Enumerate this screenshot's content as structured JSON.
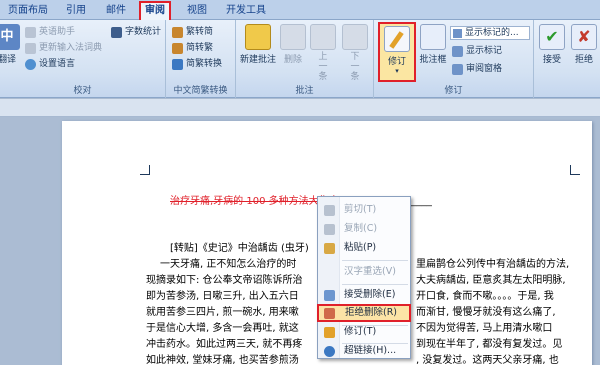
{
  "tabs": [
    "页面布局",
    "引用",
    "邮件",
    "审阅",
    "视图",
    "开发工具"
  ],
  "proofing": {
    "translate": "翻译",
    "english_assistant": "英语助手",
    "update_ime": "更新输入法词典",
    "set_language": "设置语言",
    "word_count": "字数统计",
    "group_label": "校对"
  },
  "chinese_convert": {
    "to_simplified": "繁转简",
    "to_traditional": "简转繁",
    "convert": "简繁转换",
    "group_label": "中文简繁转换"
  },
  "comments": {
    "new": "新建批注",
    "delete": "删除",
    "prev": "上一条",
    "next": "下一条",
    "group_label": "批注"
  },
  "tracking": {
    "track_changes": "修订",
    "balloons": "批注框",
    "display_for_review": "显示标记的...",
    "show_markup": "显示标记",
    "reviewing_pane": "审阅窗格",
    "group_label": "修订"
  },
  "changes": {
    "accept": "接受",
    "reject": "拒绝"
  },
  "document": {
    "deleted_line": "治疗牙痛,牙病的 100 多种方法大集合",
    "underline_tail": "____________",
    "lines": [
      "[转贴]《史记》中治龋齿 (虫牙)",
      "一天牙痛, 正不知怎么治疗的时",
      "现摘录如下: 仓公奉文帝诏陈诉所治",
      "即为苦参汤, 日嗽三升, 出入五六日",
      "就用苦参三四片, 煎一碗水, 用来嗽",
      "于是信心大增, 多含一会再吐, 就这",
      "冲击药水。如此过两三天, 就不再疼",
      "如此神效, 堂妹牙痛, 也买苦参煎汤"
    ],
    "right_lines": [
      "里扁鹊仓公列传中有治龋齿的方法,",
      "大夫病龋齿, 臣意炙其左太阳明脉,",
      "开口食, 食而不嗽。。。。于是, 我",
      "而渐甘, 慢慢牙就没有这么痛了,",
      "不因为觉得苦, 马上用清水嗽口",
      "到现在半年了, 都没有复发过。见",
      "  , 没复发过。这两天父亲牙痛, 也"
    ]
  },
  "context_menu": {
    "items": [
      "剪切(T)",
      "复制(C)",
      "粘贴(P)",
      "汉字重选(V)",
      "接受删除(E)",
      "拒绝删除(R)",
      "修订(T)",
      "超链接(H)..."
    ]
  },
  "colors": {
    "highlight_border": "#e0202a",
    "deleted_text": "#e0202a"
  }
}
